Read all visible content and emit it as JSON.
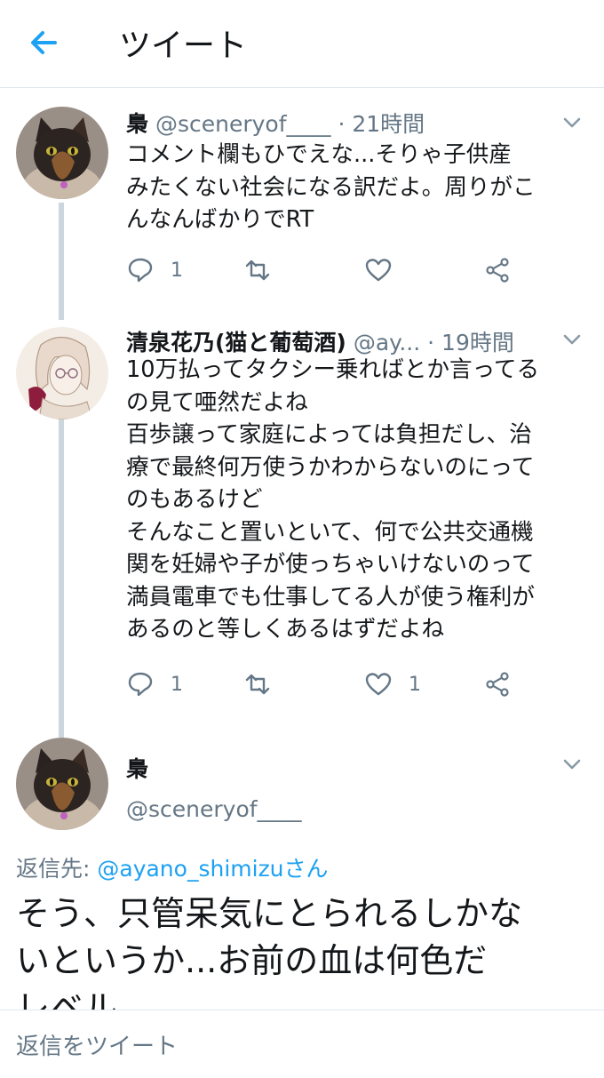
{
  "header": {
    "title": "ツイート"
  },
  "tweets": [
    {
      "name": "梟",
      "handle": "@sceneryof____",
      "time": "· 21時間",
      "text": "コメント欄もひでえな...そりゃ子供産\nみたくない社会になる訳だよ。周りがこ\nんなんばかりでRT",
      "reply_count": "1",
      "retweet_count": "",
      "like_count": "",
      "avatar": "cat-avatar"
    },
    {
      "name": "清泉花乃(猫と葡萄酒)",
      "handle": "@ay...",
      "time": "· 19時間",
      "text": "10万払ってタクシー乗ればとか言ってる\nの見て唖然だよね\n百歩譲って家庭によっては負担だし、治\n療で最終何万使うかわからないのにって\nのもあるけど\nそんなこと置いといて、何で公共交通機\n関を妊婦や子が使っちゃいけないのって\n満員電車でも仕事してる人が使う権利が\nあるのと等しくあるはずだよね",
      "reply_count": "1",
      "retweet_count": "",
      "like_count": "1",
      "avatar": "anime-girl-avatar"
    }
  ],
  "main_tweet": {
    "name": "梟",
    "handle": "@sceneryof____",
    "reply_label": "返信先: ",
    "reply_mention": "@ayano_shimizuさん",
    "text": "そう、只管呆気にとられるしかな\nいというか...お前の血は何色だ\nレベル"
  },
  "composer": {
    "placeholder": "返信をツイート"
  },
  "colors": {
    "accent": "#1da1f2",
    "secondary": "#657786",
    "thread_line": "#ccd6dd"
  }
}
